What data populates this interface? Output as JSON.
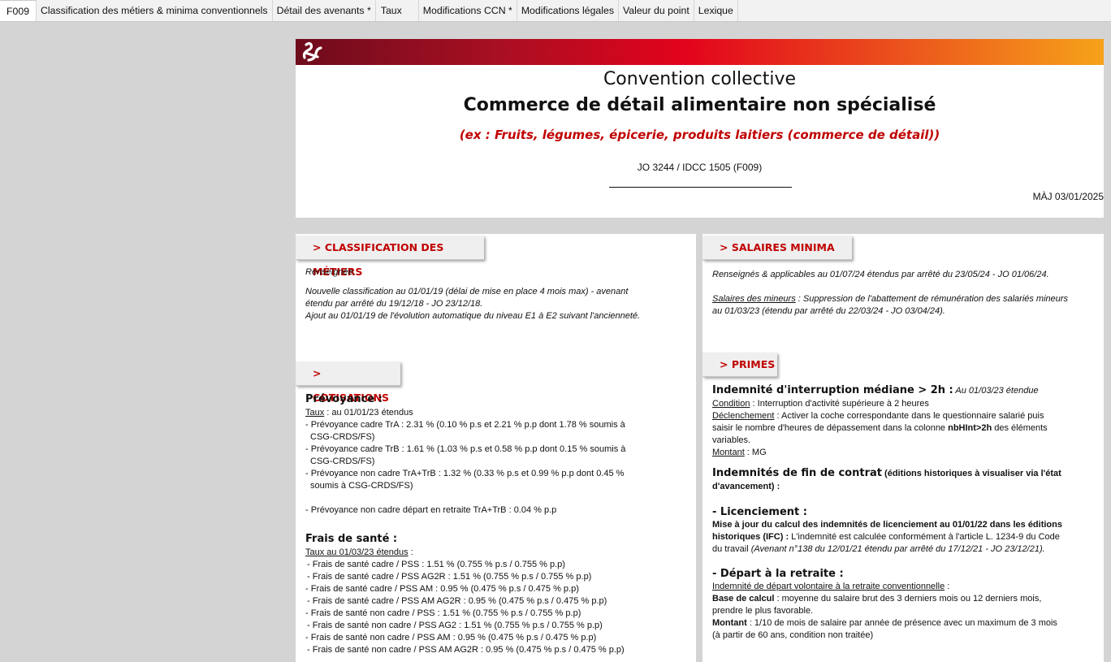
{
  "tabs": [
    {
      "label": "F009"
    },
    {
      "label": "Classification des métiers & minima conventionnels"
    },
    {
      "label": "Détail des avenants *"
    },
    {
      "label": "Taux"
    },
    {
      "label": "Modifications CCN *"
    },
    {
      "label": "Modifications légales"
    },
    {
      "label": "Valeur du point"
    },
    {
      "label": "Lexique"
    }
  ],
  "header": {
    "line1": "Convention collective",
    "line2": "Commerce de détail alimentaire non spécialisé",
    "line3": "(ex : Fruits, légumes, épicerie, produits laitiers (commerce de détail))",
    "jo": "JO 3244 / IDCC 1505 (F009)",
    "maj": "MÀJ 03/01/2025",
    "colors": {
      "gradient_start": "#6d0c1c",
      "gradient_mid": "#e2031c",
      "gradient_end": "#f6a21a",
      "accent": "#c00000"
    }
  },
  "classification": {
    "title": "> CLASSIFICATION DES MÉTIERS",
    "p1": "Renseignée.",
    "p2a": "Nouvelle classification au 01/01/19 (délai de mise en place 4 mois max) - avenant",
    "p2b": "étendu par arrêté du 19/12/18 - JO 23/12/18.",
    "p3": "Ajout au 01/01/19 de l'évolution automatique du niveau E1 à E2 suivant l'ancienneté."
  },
  "cotisations": {
    "title": "> COTISATIONS",
    "prev_title": "Prévoyance :",
    "prev_taux_label": "Taux",
    "prev_taux_text": " : au 01/01/23 étendus",
    "prev": [
      {
        "a": "- Prévoyance cadre TrA : 2.31 % (0.10 % p.s et 2.21 % p.p dont 1.78 % soumis à",
        "b": "CSG-CRDS/FS)"
      },
      {
        "a": "- Prévoyance cadre TrB : 1.61 % (1.03 % p.s et 0.58 % p.p dont 0.15 % soumis à",
        "b": "CSG-CRDS/FS)"
      },
      {
        "a": "- Prévoyance non cadre TrA+TrB : 1.32 % (0.33 % p.s et 0.99 % p.p dont 0.45 %",
        "b": "soumis à CSG-CRDS/FS)"
      }
    ],
    "prev_retraite": "- Prévoyance non cadre départ en retraite TrA+TrB : 0.04 % p.p",
    "fs_title": "Frais de santé :",
    "fs_taux": "Taux au 01/03/23 étendus",
    "fs_taux_after": " :",
    "fs_lines": [
      "- Frais de santé cadre / PSS : 1.51 % (0.755 % p.s / 0.755 % p.p)",
      "- Frais de santé cadre / PSS AG2R : 1.51 % (0.755 % p.s / 0.755 % p.p)",
      "- Frais de santé cadre / PSS AM : 0.95 % (0.475 % p.s / 0.475 % p.p)",
      "- Frais de santé cadre / PSS AM AG2R : 0.95 % (0.475 % p.s / 0.475 % p.p)",
      "- Frais de santé non cadre / PSS : 1.51 % (0.755 % p.s / 0.755 % p.p)",
      "- Frais de santé non cadre / PSS AG2 : 1.51 % (0.755 % p.s / 0.755 % p.p)",
      "- Frais de santé non cadre / PSS AM : 0.95 % (0.475 % p.s / 0.475 % p.p)",
      "- Frais de santé non cadre / PSS AM AG2R : 0.95 % (0.475 % p.s / 0.475 % p.p)"
    ]
  },
  "salaires": {
    "title": "> SALAIRES MINIMA",
    "p1": "Renseignés & applicables au 01/07/24 étendus par arrêté du 23/05/24 - JO 01/06/24.",
    "p2_label": "Salaires des mineurs",
    "p2_text": " : Suppression de l'abattement de rémunération des salariés mineurs",
    "p2_b": "au 01/03/23 (étendu par arrêté du 22/03/24 - JO 03/04/24)."
  },
  "primes": {
    "title": "> PRIMES",
    "imh_title": "Indemnité d'interruption médiane > 2h :",
    "imh_date": "  Au 01/03/23 étendue",
    "cond_label": "Condition",
    "cond_text": " : Interruption d'activité supérieure à 2 heures",
    "decl_label": "Déclenchement",
    "decl_text_a": " : Activer la coche correspondante dans le questionnaire salarié puis",
    "decl_text_b1": "saisir le nombre d'heures de dépassement dans la colonne ",
    "decl_bold": "nbHInt>2h",
    "decl_text_b2": " des éléments",
    "decl_text_c": "variables.",
    "montant_label": "Montant",
    "montant_text": " : MG",
    "ifc_title": "Indemnités de fin de contrat",
    "ifc_note_a": " (éditions historiques à visualiser via l'état",
    "ifc_note_b": "d'avancement) :",
    "lic_title": "- Licenciement :",
    "lic_b1": "Mise à jour du calcul des indemnités de licenciement au 01/01/22 dans les éditions",
    "lic_b2": "historiques (IFC) :",
    "lic_t2": " L'indemnité est calculée conformément à l'article L. 1234-9 du Code",
    "lic_t3": "du travail ",
    "lic_i3": "(Avenant n°138 du 12/01/21 étendu par arrêté du 17/12/21 - JO 23/12/21).",
    "ret_title": "- Départ à la retraite :",
    "ret_u": "Indemnité de départ volontaire à la retraite conventionnelle",
    "ret_u_after": " :",
    "base_label": "Base de calcul",
    "base_text": " : moyenne du salaire brut des 3 derniers mois ou 12 derniers mois,",
    "base_text2": "prendre le plus favorable.",
    "ret_montant_label": "Montant",
    "ret_montant_text": " : 1/10 de mois de  salaire par année de présence avec un maximum de 3 mois",
    "ret_montant_text2": "(à partir de 60 ans, condition non traitée)"
  }
}
